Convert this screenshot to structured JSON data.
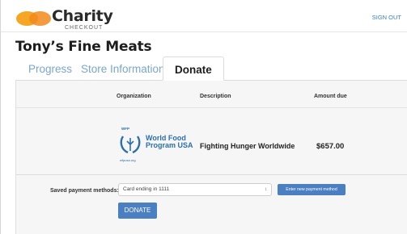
{
  "header": {
    "brand": "Charity",
    "brand_sub": "CHECKOUT",
    "signout": "SIGN OUT",
    "colors": {
      "logo_left": "#f5a623",
      "logo_right": "#f28a1c",
      "link": "#3a7dc9"
    }
  },
  "page": {
    "title": "Tony’s Fine Meats"
  },
  "tabs": [
    {
      "label": "Progress",
      "active": false
    },
    {
      "label": "Store Information",
      "active": false
    },
    {
      "label": "Donate",
      "active": true
    }
  ],
  "table": {
    "headers": {
      "organization": "Organization",
      "description": "Description",
      "amount": "Amount due"
    },
    "row": {
      "org_logo": {
        "badge": "WFP",
        "line1": "World Food",
        "line2": "Program USA",
        "url": "wfpusa.org",
        "icon": "wfp-laurel-icon"
      },
      "description": "Fighting Hunger Worldwide",
      "amount": "$657.00"
    }
  },
  "payment": {
    "label": "Saved payment methods:",
    "selected": "Card ending in 1111",
    "new_button": "Enter new payment method",
    "donate_button": "DONATE"
  },
  "accent": "#4a7fc1"
}
